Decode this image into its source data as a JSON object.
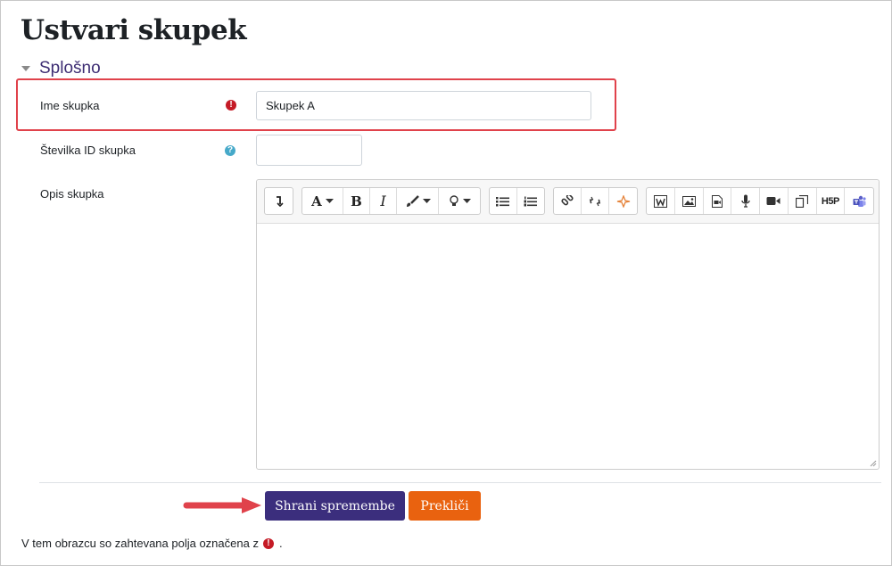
{
  "page": {
    "title": "Ustvari skupek",
    "section_title": "Splošno"
  },
  "form": {
    "name_label": "Ime skupka",
    "name_value": "Skupek A",
    "idnumber_label": "Številka ID skupka",
    "idnumber_value": "",
    "description_label": "Opis skupka",
    "required_icon": "!",
    "help_icon": "?"
  },
  "editor": {
    "toolbar": {
      "groups": [
        [
          "collapse"
        ],
        [
          "font-color",
          "bold",
          "italic",
          "background-color",
          "accessibility"
        ],
        [
          "unordered-list",
          "ordered-list"
        ],
        [
          "link",
          "unlink",
          "stamp"
        ],
        [
          "word-import",
          "image",
          "media",
          "record-audio",
          "record-video",
          "manage-files",
          "h5p",
          "teams-meeting"
        ]
      ],
      "bold_label": "B",
      "italic_label": "I",
      "font_label": "A",
      "h5p_label": "H5P"
    }
  },
  "actions": {
    "save_label": "Shrani spremembe",
    "cancel_label": "Prekliči",
    "save_color": "#3b2e7d",
    "cancel_color": "#e9620f"
  },
  "footer": {
    "required_note_prefix": "V tem obrazcu so zahtevana polja označena z",
    "required_note_suffix": "."
  }
}
